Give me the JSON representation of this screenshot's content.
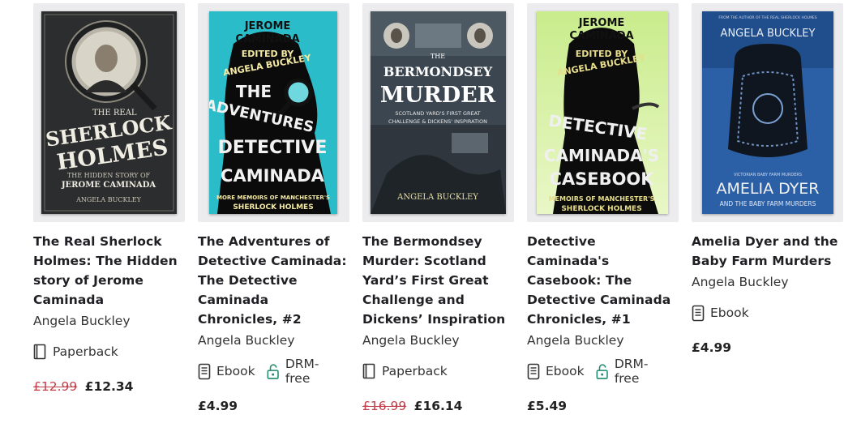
{
  "books": [
    {
      "title": "The Real Sherlock Holmes: The Hidden story of Jerome Caminada",
      "author": "Angela Buckley",
      "format": "Paperback",
      "old_price": "£12.99",
      "price": "£12.34",
      "cover_text": {
        "top": "THE REAL",
        "big1": "SHERLOCK",
        "big2": "HOLMES",
        "sub1": "THE HIDDEN STORY OF",
        "sub2": "JEROME CAMINADA",
        "author": "ANGELA BUCKLEY"
      }
    },
    {
      "title": "The Adventures of Detective Caminada: The Detective Caminada Chronicles, #2",
      "author": "Angela Buckley",
      "format": "Ebook",
      "drm": "DRM-free",
      "price": "£4.99",
      "cover_text": {
        "top1": "JEROME",
        "top2": "CAMINADA",
        "ed1": "EDITED BY",
        "ed2": "ANGELA BUCKLEY",
        "big1": "THE",
        "big2": "ADVENTURES",
        "big3": "DETECTIVE",
        "big4": "CAMINADA",
        "foot1": "MORE MEMOIRS OF MANCHESTER'S",
        "foot2": "SHERLOCK HOLMES"
      }
    },
    {
      "title": "The Bermondsey Murder: Scotland Yard’s First Great Challenge and Dickens’ Inspiration",
      "author": "Angela Buckley",
      "format": "Paperback",
      "old_price": "£16.99",
      "price": "£16.14",
      "cover_text": {
        "the": "THE",
        "big1": "BERMONDSEY",
        "big2": "MURDER",
        "sub1": "SCOTLAND YARD'S FIRST GREAT",
        "sub2": "CHALLENGE & DICKENS' INSPIRATION",
        "author": "ANGELA BUCKLEY"
      }
    },
    {
      "title": "Detective Caminada's Casebook: The Detective Caminada Chronicles, #1",
      "author": "Angela Buckley",
      "format": "Ebook",
      "drm": "DRM-free",
      "price": "£5.49",
      "cover_text": {
        "top1": "JEROME",
        "top2": "CAMINADA",
        "ed1": "EDITED BY",
        "ed2": "ANGELA BUCKLEY",
        "big1": "DETECTIVE",
        "big2": "CAMINADA'S",
        "big3": "CASEBOOK",
        "foot1": "MEMOIRS OF MANCHESTER'S",
        "foot2": "SHERLOCK HOLMES"
      }
    },
    {
      "title": "Amelia Dyer and the Baby Farm Murders",
      "author": "Angela Buckley",
      "format": "Ebook",
      "price": "£4.99",
      "cover_text": {
        "top": "FROM THE AUTHOR OF THE REAL SHERLOCK HOLMES",
        "author": "ANGELA BUCKLEY",
        "small": "VICTORIAN BABY FARM MURDERS",
        "big1": "AMELIA DYER",
        "sub": "AND THE BABY FARM MURDERS"
      }
    }
  ]
}
